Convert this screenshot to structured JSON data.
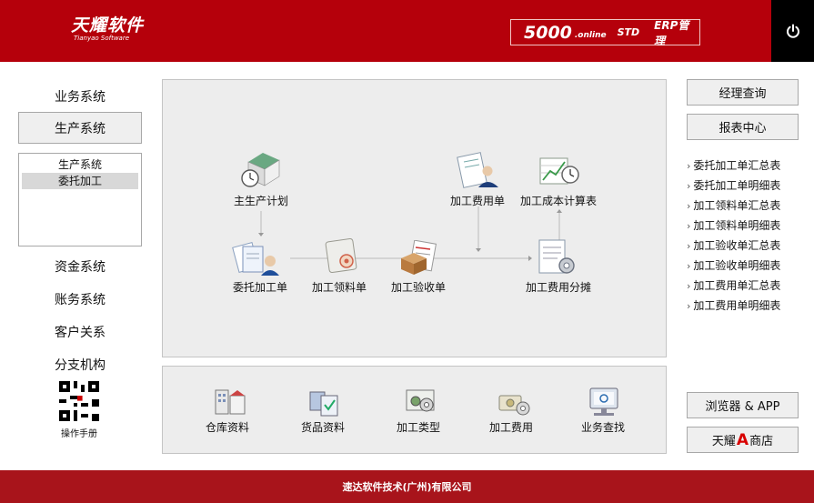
{
  "header": {
    "logo_cn": "天耀软件",
    "logo_en": "Tianyao Software",
    "product_num": "5000",
    "product_online": ".online",
    "product_std": "STD",
    "product_erp": "ERP管理"
  },
  "left_nav": {
    "business": "业务系统",
    "production": "生产系统",
    "sub_items": [
      "生产系统",
      "委托加工"
    ],
    "funds": "资金系统",
    "accounts": "账务系统",
    "customer": "客户关系",
    "branch": "分支机构",
    "manual": "操作手册"
  },
  "flow": {
    "plan": "主生产计划",
    "outsource": "委托加工单",
    "material": "加工领料单",
    "acceptance": "加工验收单",
    "fee_bill": "加工费用单",
    "cost_calc": "加工成本计算表",
    "fee_alloc": "加工费用分摊"
  },
  "bottom": {
    "warehouse": "仓库资料",
    "goods": "货品资料",
    "process_type": "加工类型",
    "process_fee": "加工费用",
    "query": "业务查找"
  },
  "right": {
    "manager_query": "经理查询",
    "report_center": "报表中心",
    "links": [
      "委托加工单汇总表",
      "委托加工单明细表",
      "加工领料单汇总表",
      "加工领料单明细表",
      "加工验收单汇总表",
      "加工验收单明细表",
      "加工费用单汇总表",
      "加工费用单明细表"
    ],
    "browser_app": "浏览器 & APP",
    "shop_pre": "天耀",
    "shop_a": "A",
    "shop_post": "商店"
  },
  "footer": {
    "company": "速达软件技术(广州)有限公司"
  }
}
